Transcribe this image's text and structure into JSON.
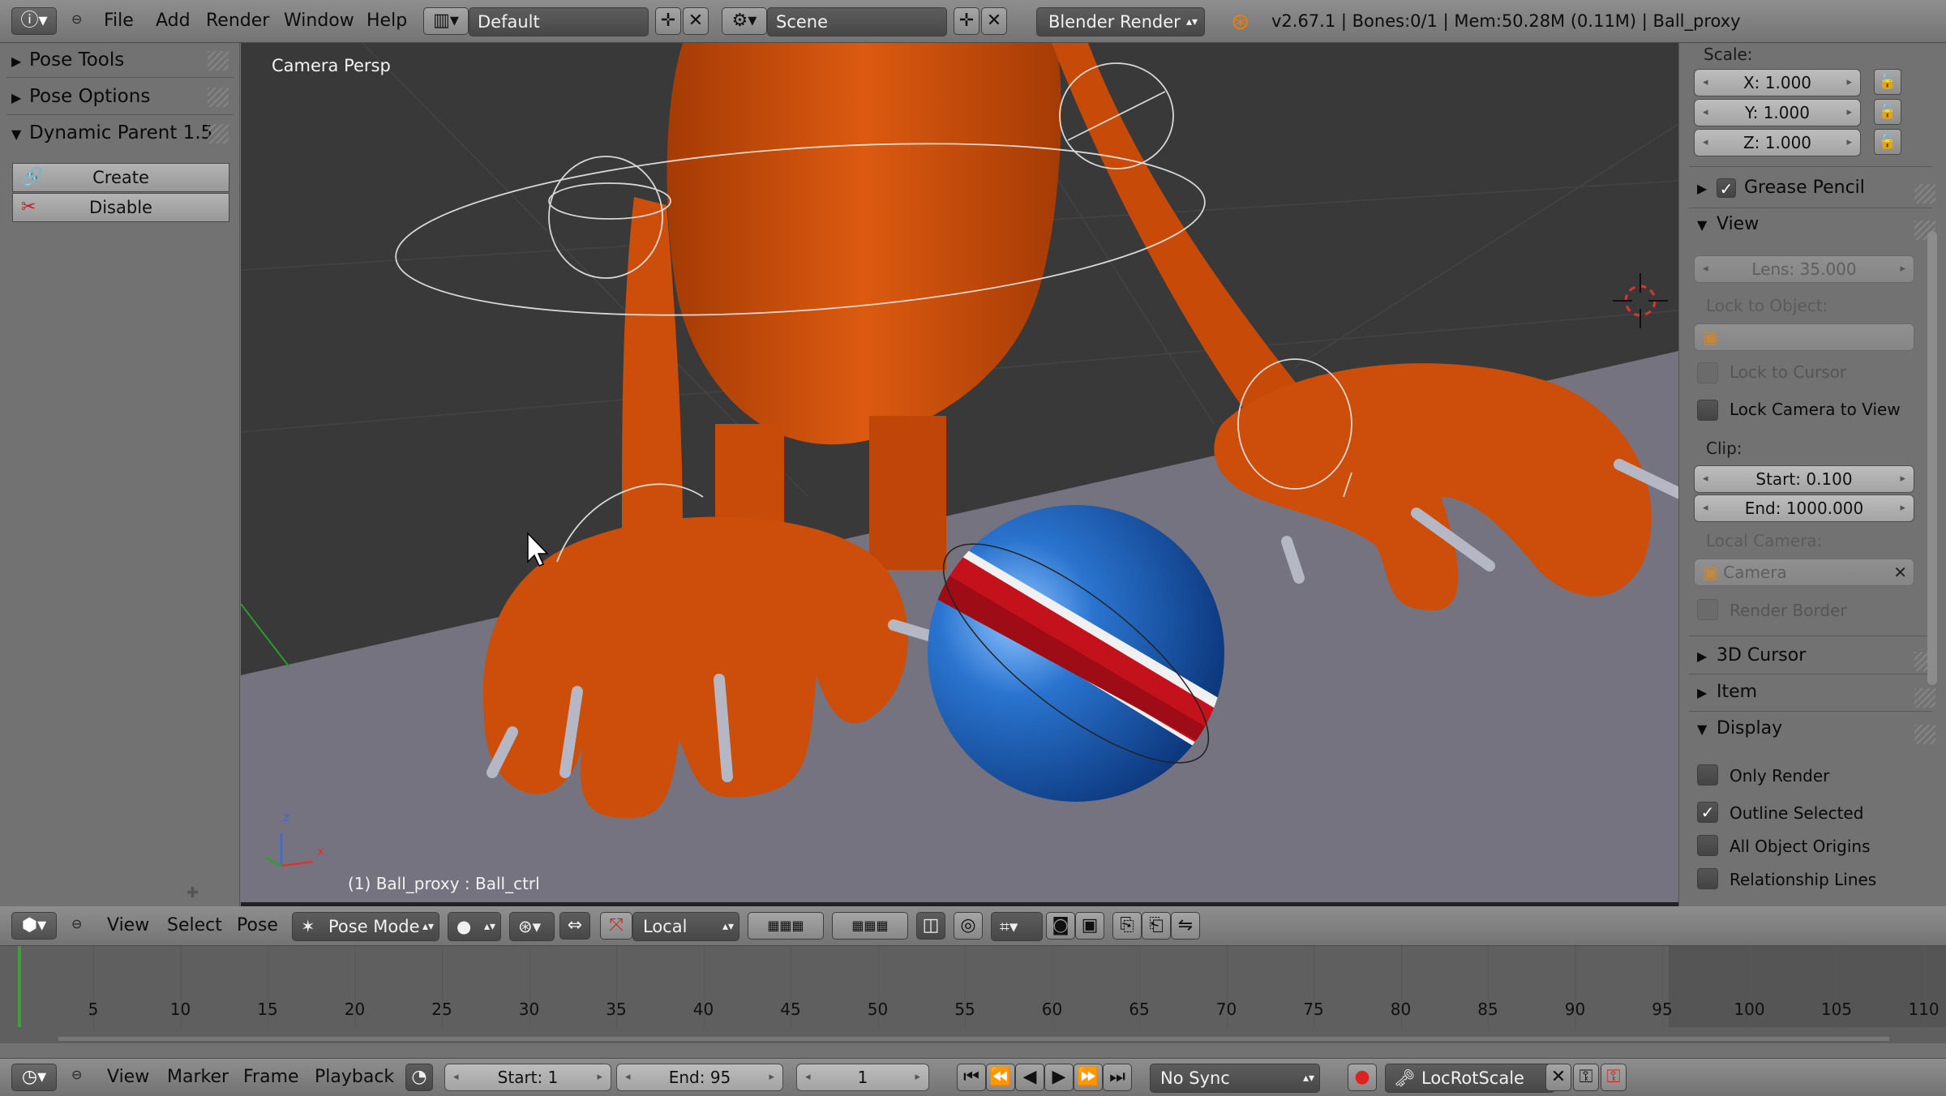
{
  "top_header": {
    "info_icon": "info-icon",
    "menus": [
      "File",
      "Add",
      "Render",
      "Window",
      "Help"
    ],
    "screen_layout": "Default",
    "scene": "Scene",
    "render_engine": "Blender Render",
    "stats": "v2.67.1 | Bones:0/1 | Mem:50.28M (0.11M) | Ball_proxy"
  },
  "tool_shelf": {
    "panels": [
      {
        "label": "Pose Tools",
        "expanded": false
      },
      {
        "label": "Pose Options",
        "expanded": false
      },
      {
        "label": "Dynamic Parent 1.5",
        "expanded": true
      }
    ],
    "buttons": {
      "create": "Create",
      "disable": "Disable"
    }
  },
  "viewport": {
    "view_name": "Camera Persp",
    "object_label": "(1) Ball_proxy : Ball_ctrl",
    "axis_labels": {
      "z": "z",
      "x": "x"
    },
    "colors": {
      "character": "#cc4e0a",
      "ball_blue": "#1f5fb3",
      "ball_red": "#c4121c",
      "floor": "#75737f",
      "background": "#393939"
    }
  },
  "properties": {
    "scale_label": "Scale:",
    "scale": {
      "x": "X: 1.000",
      "y": "Y: 1.000",
      "z": "Z: 1.000"
    },
    "sections": {
      "grease_pencil": "Grease Pencil",
      "view": "View",
      "cursor3d": "3D Cursor",
      "item": "Item",
      "display": "Display"
    },
    "grease_pencil_checked": true,
    "view": {
      "lens": "Lens: 35.000",
      "lock_to_object_label": "Lock to Object:",
      "lock_to_cursor": "Lock to Cursor",
      "lock_camera_to_view": "Lock Camera to View",
      "clip_label": "Clip:",
      "clip_start": "Start: 0.100",
      "clip_end": "End: 1000.000",
      "local_camera_label": "Local Camera:",
      "local_camera": "Camera",
      "render_border": "Render Border"
    },
    "display": {
      "only_render": {
        "label": "Only Render",
        "checked": false
      },
      "outline_selected": {
        "label": "Outline Selected",
        "checked": true
      },
      "all_object_origins": {
        "label": "All Object Origins",
        "checked": false
      },
      "relationship_lines": {
        "label": "Relationship Lines",
        "checked": false
      }
    }
  },
  "view3d_header": {
    "menus": [
      "View",
      "Select",
      "Pose"
    ],
    "mode": "Pose Mode",
    "orientation": "Local"
  },
  "timeline": {
    "ticks": [
      "5",
      "10",
      "15",
      "20",
      "25",
      "30",
      "35",
      "40",
      "45",
      "50",
      "55",
      "60",
      "65",
      "70",
      "75",
      "80",
      "85",
      "90",
      "95",
      "100",
      "105",
      "110"
    ],
    "current_frame_marker": 1
  },
  "timeline_header": {
    "menus": [
      "View",
      "Marker",
      "Frame",
      "Playback"
    ],
    "start": "Start: 1",
    "end": "End: 95",
    "current_frame": "1",
    "sync": "No Sync",
    "keying_set": "LocRotScale"
  }
}
